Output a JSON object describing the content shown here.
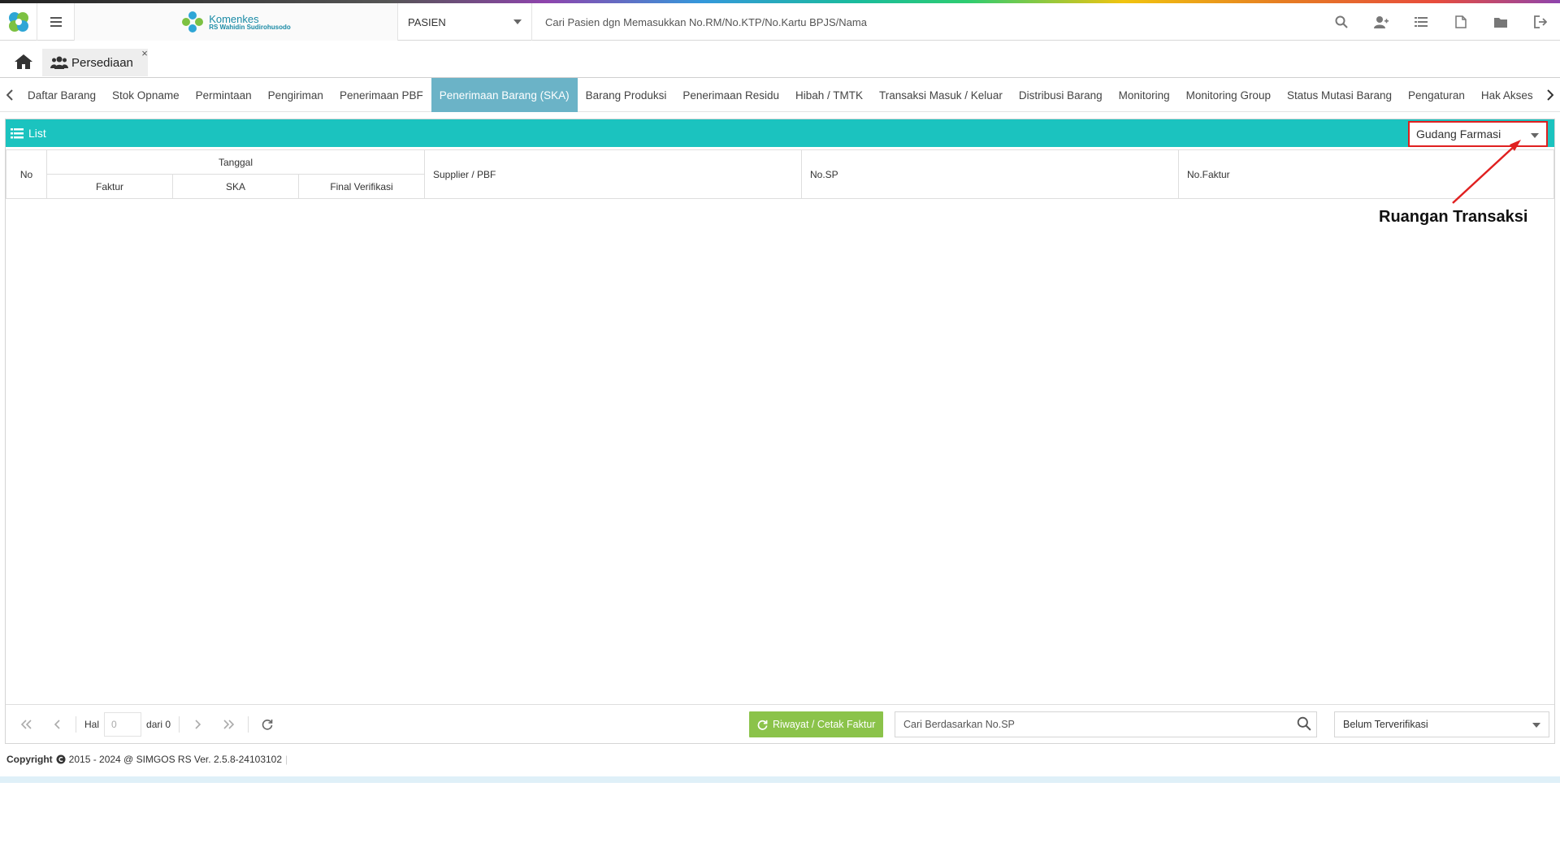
{
  "header": {
    "brand_title": "Komenkes",
    "brand_subtitle": "RS Wahidin Sudirohusodo",
    "patient_select": "PASIEN",
    "patient_search_placeholder": "Cari Pasien dgn Memasukkan No.RM/No.KTP/No.Kartu BPJS/Nama",
    "icons": [
      "search-icon",
      "user-plus-icon",
      "list-icon",
      "pdf-icon",
      "folder-icon",
      "logout-icon"
    ]
  },
  "tabs": {
    "home_icon": "home-icon",
    "app_tab_label": "Persediaan",
    "close_symbol": "×"
  },
  "menu": {
    "items": [
      "Daftar Barang",
      "Stok Opname",
      "Permintaan",
      "Pengiriman",
      "Penerimaan PBF",
      "Penerimaan Barang (SKA)",
      "Barang Produksi",
      "Penerimaan Residu",
      "Hibah / TMTK",
      "Transaksi Masuk / Keluar",
      "Distribusi Barang",
      "Monitoring",
      "Monitoring Group",
      "Status Mutasi Barang",
      "Pengaturan",
      "Hak Akses"
    ],
    "active_index": 5
  },
  "panel": {
    "title": "List",
    "ruangan_value": "Gudang Farmasi",
    "columns": {
      "no": "No",
      "tanggal": "Tanggal",
      "faktur": "Faktur",
      "ska": "SKA",
      "final_verifikasi": "Final Verifikasi",
      "supplier": "Supplier / PBF",
      "no_sp": "No.SP",
      "no_faktur": "No.Faktur"
    },
    "rows": []
  },
  "pager": {
    "hal_label": "Hal",
    "page_value": "0",
    "of_label": "dari 0",
    "riwayat_label": "Riwayat / Cetak Faktur",
    "search_placeholder": "Cari Berdasarkan No.SP",
    "status_value": "Belum Terverifikasi"
  },
  "footer": {
    "copyright_bold": "Copyright",
    "copyright_text": "2015 - 2024 @ SIMGOS RS Ver. 2.5.8-24103102"
  },
  "annotation": {
    "label": "Ruangan Transaksi",
    "color": "#e02020"
  },
  "colors": {
    "panel_header": "#1bc3bf",
    "active_tab": "#6bb3c7",
    "riwayat_button": "#8bc34a"
  }
}
